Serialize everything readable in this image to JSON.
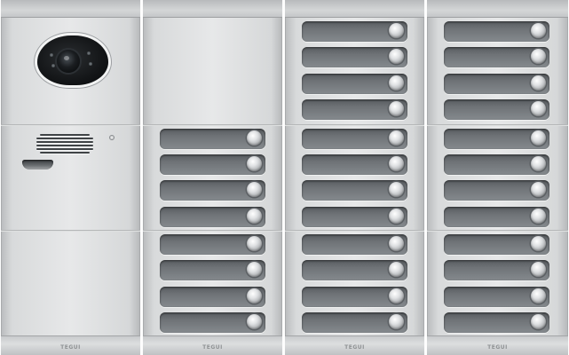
{
  "panel": {
    "brand_text": "TEGUI",
    "columns": [
      {
        "name": "camera-speaker-module",
        "button_count": 0
      },
      {
        "name": "push-button-module-2",
        "button_count": 8
      },
      {
        "name": "push-button-module-3",
        "button_count": 12
      },
      {
        "name": "push-button-module-4",
        "button_count": 12
      }
    ],
    "colors": {
      "aluminium": "#e2e3e4",
      "button_plate": "#6e7276",
      "knob": "#dfe1e3",
      "camera": "#141618"
    },
    "icons": [
      "camera-icon",
      "speaker-grille-icon",
      "push-button-icon",
      "status-light-icon"
    ]
  }
}
